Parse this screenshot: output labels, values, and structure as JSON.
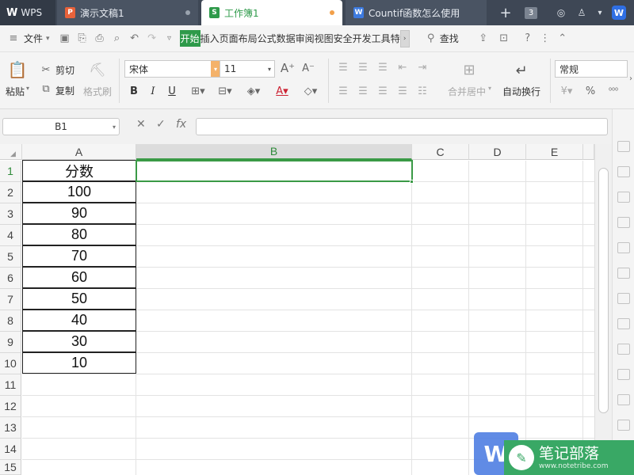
{
  "tabs": {
    "app": "WPS",
    "doc1": "演示文稿1",
    "doc2": "工作簿1",
    "doc3": "Countif函数怎么使用",
    "window_count": "3"
  },
  "menubar": {
    "file": "文件",
    "tabs": [
      "开始",
      "插入",
      "页面布局",
      "公式",
      "数据",
      "审阅",
      "视图",
      "安全",
      "开发工具",
      "特色"
    ],
    "search": "查找"
  },
  "ribbon": {
    "paste": "粘贴",
    "cut": "剪切",
    "copy": "复制",
    "format_painter": "格式刷",
    "font_name": "宋体",
    "font_size": "11",
    "merge_center": "合并居中",
    "wrap_text": "自动换行",
    "number_format": "常规"
  },
  "formula_bar": {
    "name_box": "B1",
    "fx": "fx",
    "value": ""
  },
  "grid": {
    "columns": [
      "A",
      "B",
      "C",
      "D",
      "E"
    ],
    "rows": [
      "1",
      "2",
      "3",
      "4",
      "5",
      "6",
      "7",
      "8",
      "9",
      "10",
      "11",
      "12",
      "13",
      "14",
      "15"
    ],
    "column_a_values": [
      "分数",
      "100",
      "90",
      "80",
      "70",
      "60",
      "50",
      "40",
      "30",
      "10"
    ],
    "selected_cell": "B1"
  },
  "watermark": {
    "title": "笔记部落",
    "url": "www.notetribe.com"
  },
  "colors": {
    "accent": "#2e9a4a",
    "titlebar": "#3e4755"
  }
}
